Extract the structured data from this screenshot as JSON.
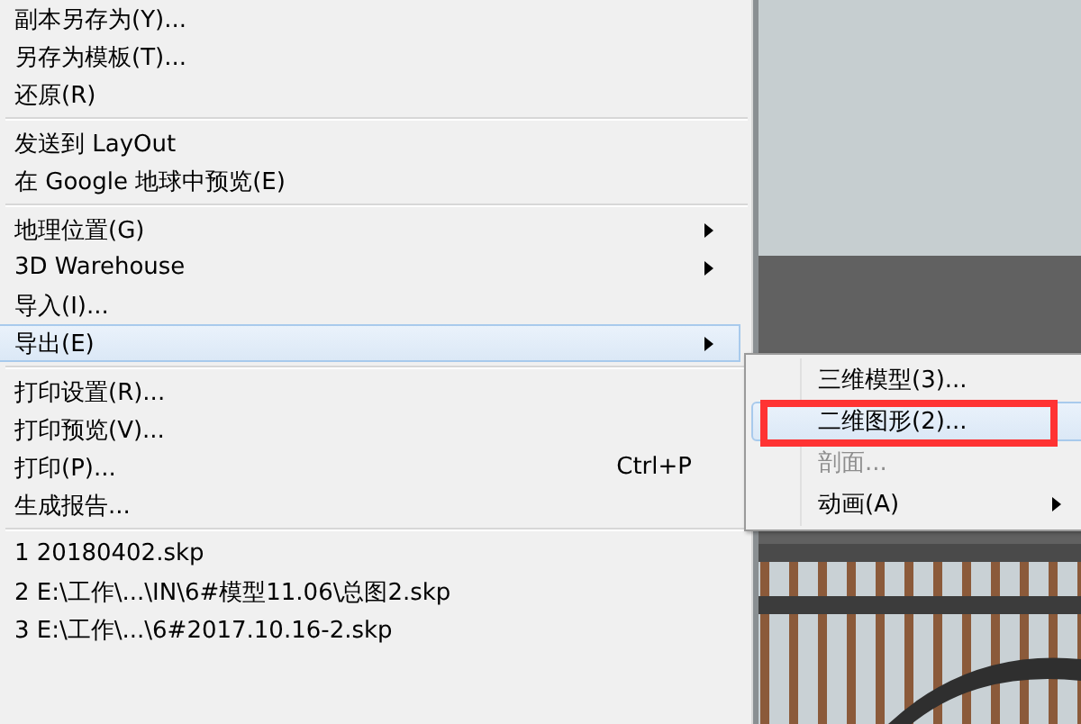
{
  "menu": {
    "sections": [
      [
        {
          "label": "副本另存为(Y)...",
          "selected": false,
          "disabled": false
        },
        {
          "label": "另存为模板(T)...",
          "selected": false,
          "disabled": false
        },
        {
          "label": "还原(R)",
          "selected": false,
          "disabled": false
        }
      ],
      [
        {
          "label": "发送到 LayOut",
          "selected": false,
          "disabled": false
        },
        {
          "label": "在 Google 地球中预览(E)",
          "selected": false,
          "disabled": false
        }
      ],
      [
        {
          "label": "地理位置(G)",
          "selected": false,
          "disabled": false,
          "submenu": true
        },
        {
          "label": "3D Warehouse",
          "selected": false,
          "disabled": false,
          "submenu": true
        },
        {
          "label": "导入(I)...",
          "selected": false,
          "disabled": false
        },
        {
          "label": "导出(E)",
          "selected": true,
          "disabled": false,
          "submenu": true
        }
      ],
      [
        {
          "label": "打印设置(R)...",
          "selected": false,
          "disabled": false
        },
        {
          "label": "打印预览(V)...",
          "selected": false,
          "disabled": false
        },
        {
          "label": "打印(P)...",
          "shortcut": "Ctrl+P",
          "selected": false,
          "disabled": false
        },
        {
          "label": "生成报告...",
          "selected": false,
          "disabled": false
        }
      ],
      [
        {
          "label": "1 20180402.skp",
          "selected": false,
          "disabled": false
        },
        {
          "label": "2 E:\\工作\\...\\IN\\6#模型11.06\\总图2.skp",
          "selected": false,
          "disabled": false
        },
        {
          "label": "3 E:\\工作\\...\\6#2017.10.16-2.skp",
          "selected": false,
          "disabled": false
        }
      ]
    ]
  },
  "submenu": {
    "items": [
      {
        "label": "三维模型(3)...",
        "selected": false,
        "disabled": false,
        "submenu": false,
        "annotated": false
      },
      {
        "label": "二维图形(2)...",
        "selected": true,
        "disabled": false,
        "submenu": false,
        "annotated": true
      },
      {
        "label": "剖面...",
        "selected": false,
        "disabled": true,
        "submenu": false,
        "annotated": false
      },
      {
        "label": "动画(A)",
        "selected": false,
        "disabled": false,
        "submenu": true,
        "annotated": false
      }
    ]
  }
}
